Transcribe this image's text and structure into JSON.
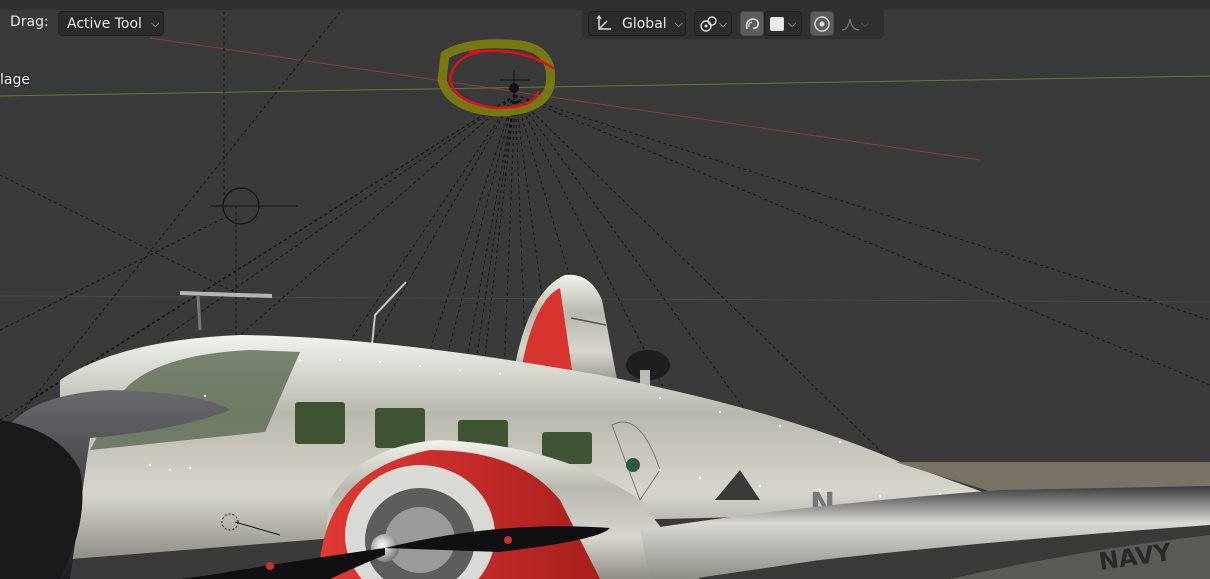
{
  "header": {
    "drag_label": "Drag:",
    "drag_value": "Active Tool",
    "orientation_value": "Global"
  },
  "viewport": {
    "object_label": "lage",
    "aircraft_marking": "N"
  },
  "icons": {
    "orientation": "transform-orientation-icon",
    "pivot": "pivot-point-icon",
    "snap": "snap-magnet-icon",
    "snap_target": "snap-target-icon",
    "proportional": "proportional-editing-icon",
    "falloff": "falloff-curve-icon"
  },
  "colors": {
    "background": "#3a3a3a",
    "x_axis": "#c94a4a",
    "y_axis": "#7aa33a",
    "annotation_red": "#e0101a",
    "annotation_highlight": "#8c8c10",
    "aircraft_red": "#d7342f"
  }
}
